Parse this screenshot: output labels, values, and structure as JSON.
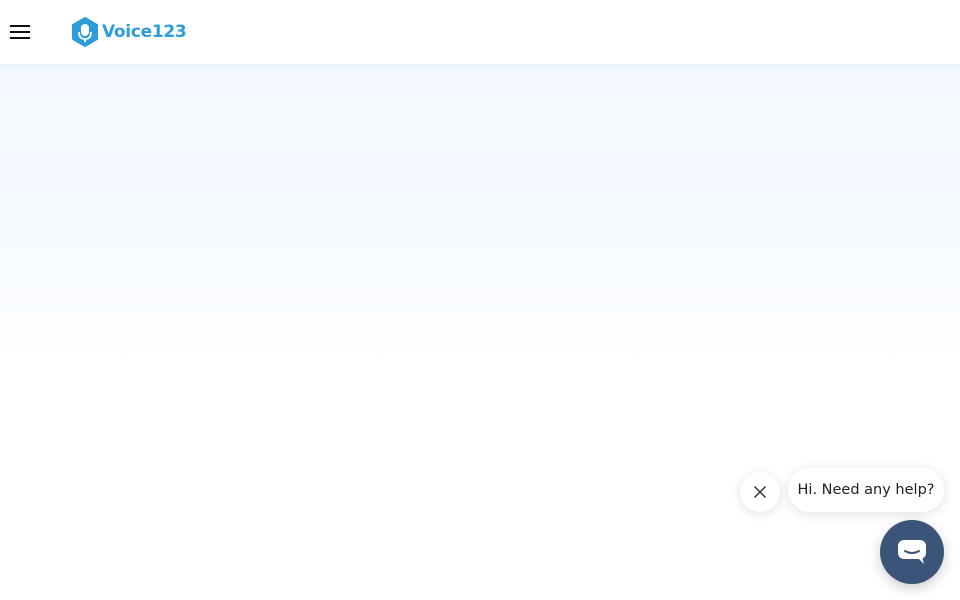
{
  "header": {
    "menu_icon": "hamburger-menu-icon",
    "logo_icon": "microphone-hexagon-icon",
    "logo_text": "Voice123"
  },
  "chat_widget": {
    "greeting": "Hi. Need any help?",
    "close_icon": "close-icon",
    "launcher_icon": "chat-bubble-icon"
  },
  "colors": {
    "brand_blue": "#2d9cdb",
    "launcher_bg": "#3a5578",
    "hero_bg": "#f3f9fe"
  }
}
